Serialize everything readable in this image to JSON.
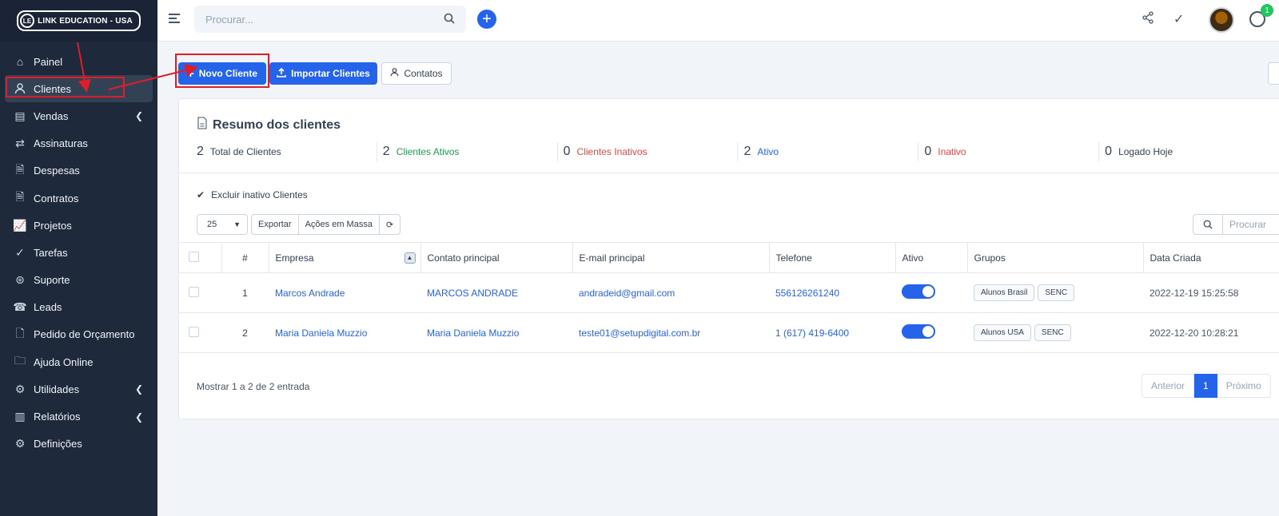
{
  "sidebar": {
    "logo_text": "LINK EDUCATION - USA",
    "items": [
      {
        "label": "Painel",
        "icon": "home-icon",
        "glyph": "⌂"
      },
      {
        "label": "Clientes",
        "icon": "user-icon",
        "glyph": "👤"
      },
      {
        "label": "Vendas",
        "icon": "receipt-icon",
        "glyph": "▤"
      },
      {
        "label": "Assinaturas",
        "icon": "repeat-icon",
        "glyph": "⇄"
      },
      {
        "label": "Despesas",
        "icon": "file-icon",
        "glyph": "🗎"
      },
      {
        "label": "Contratos",
        "icon": "contract-icon",
        "glyph": "🗎"
      },
      {
        "label": "Projetos",
        "icon": "chart-icon",
        "glyph": "📈"
      },
      {
        "label": "Tarefas",
        "icon": "check-circle-icon",
        "glyph": "✓"
      },
      {
        "label": "Suporte",
        "icon": "lifebuoy-icon",
        "glyph": "⊛"
      },
      {
        "label": "Leads",
        "icon": "leads-icon",
        "glyph": "☎"
      },
      {
        "label": "Pedido de Orçamento",
        "icon": "document-icon",
        "glyph": "🗋"
      },
      {
        "label": "Ajuda Online",
        "icon": "folder-icon",
        "glyph": "🗀"
      },
      {
        "label": "Utilidades",
        "icon": "gears-icon",
        "glyph": "⚙"
      },
      {
        "label": "Relatórios",
        "icon": "bar-chart-icon",
        "glyph": "▥"
      },
      {
        "label": "Definições",
        "icon": "gear-icon",
        "glyph": "⚙"
      }
    ]
  },
  "topbar": {
    "search_placeholder": "Procurar...",
    "notification_count": "1"
  },
  "actions": {
    "new_client": "Novo Cliente",
    "import_clients": "Importar Clientes",
    "contacts": "Contatos"
  },
  "summary": {
    "title": "Resumo dos clientes",
    "stats": [
      {
        "value": "2",
        "label": "Total de Clientes",
        "color": "#334155"
      },
      {
        "value": "2",
        "label": "Clientes Ativos",
        "color": "#16a34a"
      },
      {
        "value": "0",
        "label": "Clientes Inativos",
        "color": "#ef4444"
      },
      {
        "value": "2",
        "label": "Ativo",
        "color": "#2563eb"
      },
      {
        "value": "0",
        "label": "Inativo",
        "color": "#ef4444"
      },
      {
        "value": "0",
        "label": "Logado Hoje",
        "color": "#334155"
      }
    ]
  },
  "filters": {
    "exclude_inactive": "Excluir inativo Clientes",
    "page_size": "25",
    "export": "Exportar",
    "bulk_actions": "Ações em Massa",
    "search_placeholder": "Procurar"
  },
  "table": {
    "columns": [
      "#",
      "Empresa",
      "Contato principal",
      "E-mail principal",
      "Telefone",
      "Ativo",
      "Grupos",
      "Data Criada"
    ],
    "rows": [
      {
        "id": "1",
        "company": "Marcos Andrade",
        "contact": "MARCOS ANDRADE",
        "email": "andradeid@gmail.com",
        "phone": "556126261240",
        "groups": [
          "Alunos Brasil",
          "SENC"
        ],
        "created": "2022-12-19 15:25:58"
      },
      {
        "id": "2",
        "company": "Maria Daniela Muzzio",
        "contact": "Maria Daniela Muzzio",
        "email": "teste01@setupdigital.com.br",
        "phone": "1 (617) 419-6400",
        "groups": [
          "Alunos USA",
          "SENC"
        ],
        "created": "2022-12-20 10:28:21"
      }
    ]
  },
  "footer": {
    "showing": "Mostrar 1 a 2 de 2 entrada",
    "prev": "Anterior",
    "page": "1",
    "next": "Próximo"
  },
  "colors": {
    "sidebar_bg": "#1e293b",
    "accent": "#2563eb",
    "annotation": "#e11d2a"
  }
}
